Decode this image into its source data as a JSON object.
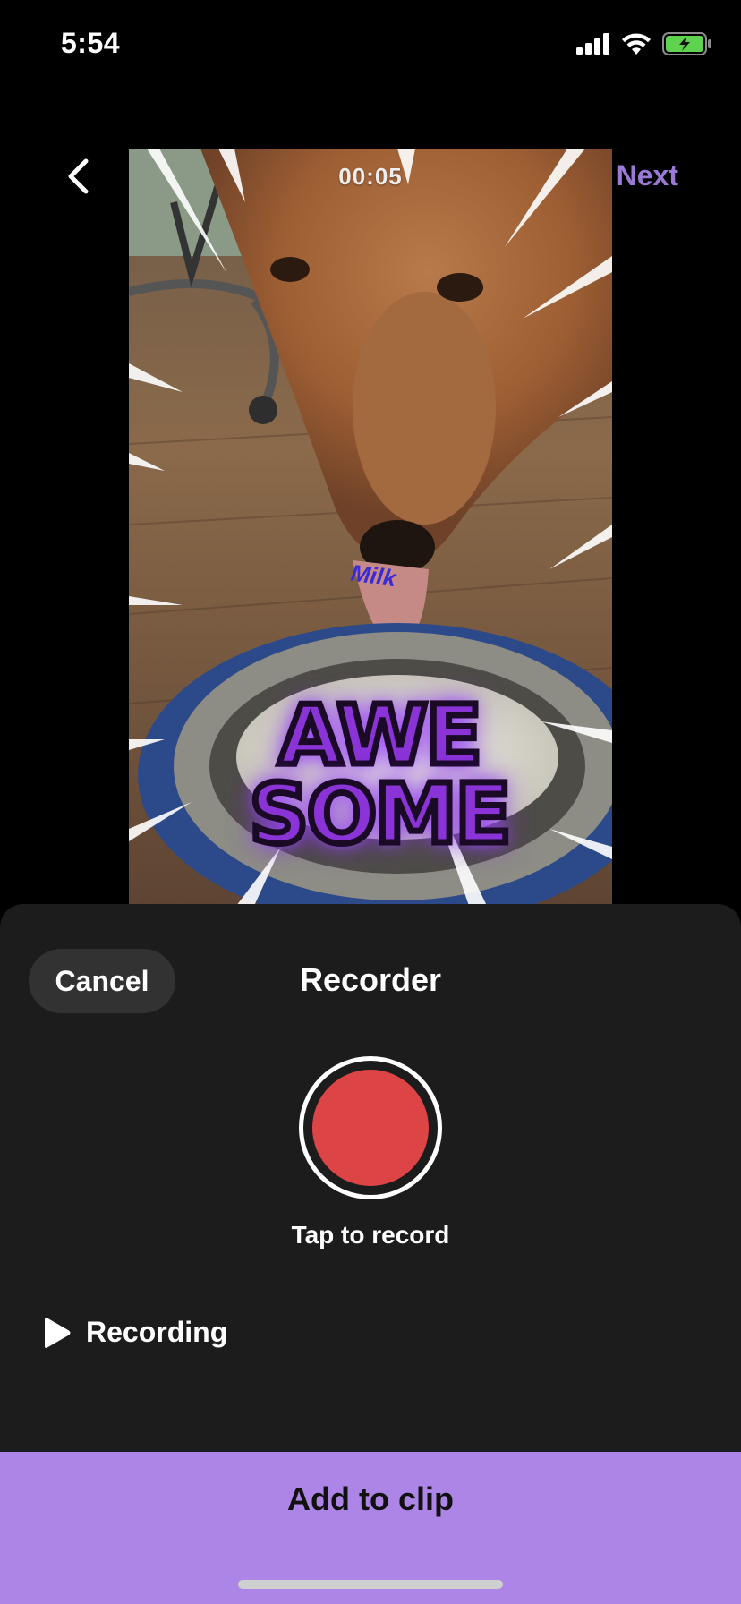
{
  "status_bar": {
    "time": "5:54",
    "icons": [
      "cellular-signal-icon",
      "wifi-icon",
      "battery-charging-icon"
    ]
  },
  "nav": {
    "back_icon": "chevron-left-icon",
    "next_label": "Next"
  },
  "preview": {
    "timecode": "00:05",
    "stickers": {
      "small_text": "Milk",
      "big_text_line1": "AWE",
      "big_text_line2": "SOME"
    }
  },
  "recorder": {
    "cancel_label": "Cancel",
    "title": "Recorder",
    "record_hint": "Tap to record",
    "recording_label": "Recording",
    "record_color": "#dc4446"
  },
  "footer": {
    "add_label": "Add to clip",
    "accent": "#ac85e6"
  }
}
